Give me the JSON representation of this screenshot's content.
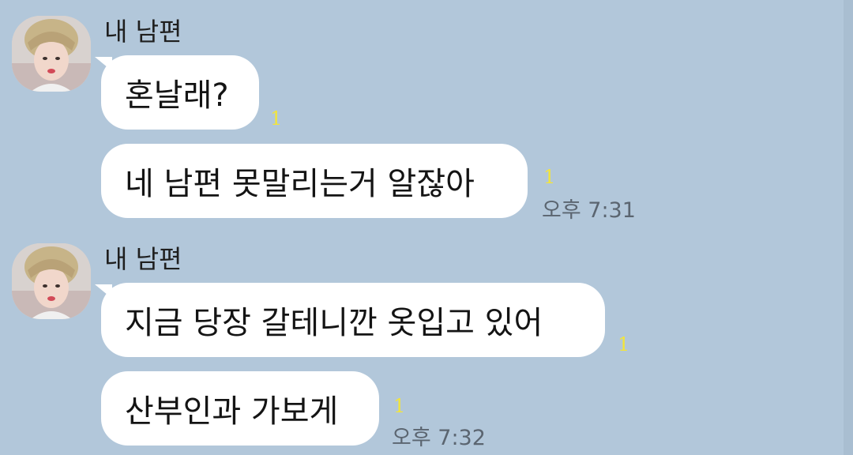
{
  "chat": {
    "groups": [
      {
        "sender": "내 남편",
        "messages": [
          {
            "text": "혼날래?",
            "unread": "1",
            "time": ""
          },
          {
            "text": "네 남편 못말리는거 알잖아",
            "unread": "1",
            "time": "오후 7:31"
          }
        ]
      },
      {
        "sender": "내 남편",
        "messages": [
          {
            "text": "지금 당장 갈테니깐 옷입고 있어",
            "unread": "1",
            "time": ""
          },
          {
            "text": "산부인과 가보게",
            "unread": "1",
            "time": "오후 7:32"
          }
        ]
      }
    ]
  },
  "icons": {
    "avatar": "profile-photo"
  },
  "colors": {
    "background": "#b2c7da",
    "bubble": "#ffffff",
    "unread": "#f3e53a",
    "time": "#5b6570"
  }
}
